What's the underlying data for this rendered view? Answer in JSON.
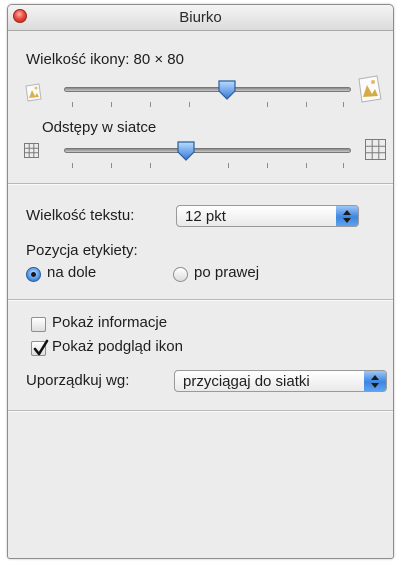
{
  "window": {
    "title": "Biurko"
  },
  "icon_size": {
    "label": "Wielkość ikony: 80 × 80",
    "value_fraction": 0.58
  },
  "grid_spacing": {
    "label": "Odstępy w siatce",
    "value_fraction": 0.43
  },
  "text_size": {
    "label": "Wielkość tekstu:",
    "selected": "12 pkt"
  },
  "label_position": {
    "label": "Pozycja etykiety:",
    "options": [
      {
        "label": "na dole",
        "selected": true
      },
      {
        "label": "po prawej",
        "selected": false
      }
    ]
  },
  "options": {
    "show_info_label": "Pokaż informacje",
    "show_info_checked": false,
    "show_preview_label": "Pokaż podgląd ikon",
    "show_preview_checked": true
  },
  "arrange": {
    "label": "Uporządkuj wg:",
    "selected": "przyciągaj do siatki"
  },
  "colors": {
    "accent": "#3d86e0",
    "close_button": "#ec4b3f"
  }
}
